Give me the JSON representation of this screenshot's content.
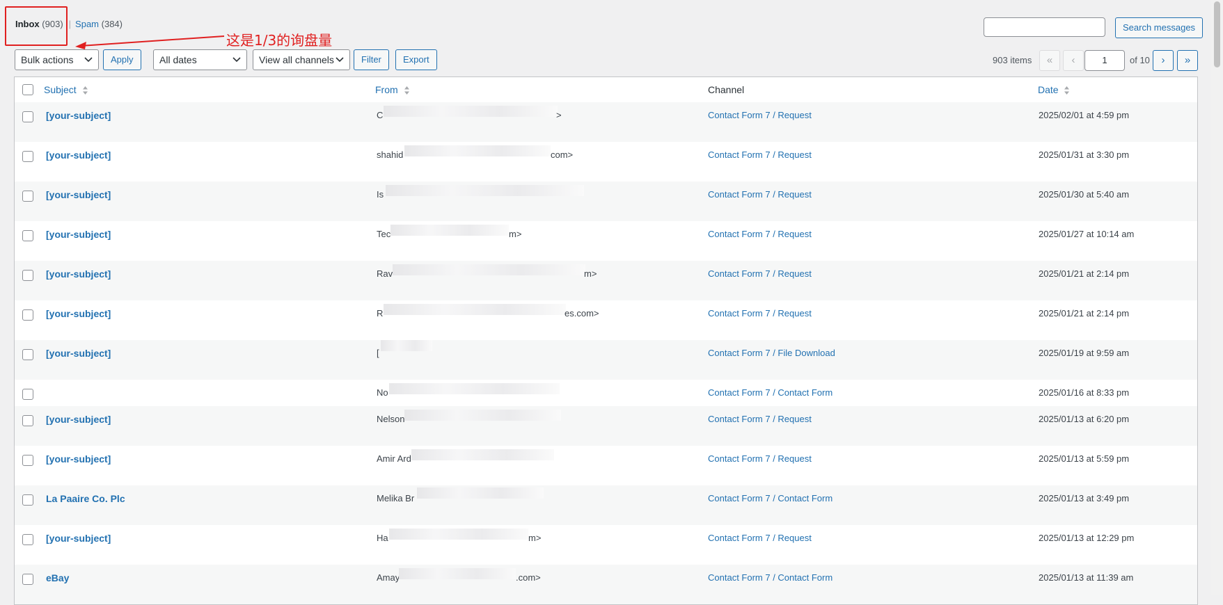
{
  "views": {
    "inbox_label": "Inbox",
    "inbox_count": "(903)",
    "separator": "|",
    "spam_label": "Spam",
    "spam_count": "(384)"
  },
  "annotation": {
    "text": "这是1/3的询盘量",
    "color": "#e02020"
  },
  "search": {
    "value": "",
    "button_label": "Search messages"
  },
  "toolbar": {
    "bulk_actions": "Bulk actions",
    "apply_label": "Apply",
    "dates_filter": "All dates",
    "channels_filter": "View all channels",
    "filter_label": "Filter",
    "export_label": "Export"
  },
  "pagination": {
    "items_count": "903 items",
    "first": "«",
    "prev": "‹",
    "current_page": "1",
    "of_total": "of 10",
    "next": "›",
    "last": "»"
  },
  "table": {
    "columns": {
      "subject": "Subject",
      "from": "From",
      "channel": "Channel",
      "date": "Date"
    },
    "rows": [
      {
        "subject": "[your-subject]",
        "from_start": "C",
        "from_end": ">",
        "channel": "Contact Form 7 / Request",
        "date": "2025/02/01 at 4:59 pm"
      },
      {
        "subject": "[your-subject]",
        "from_start": "shahid",
        "from_end": "com>",
        "channel": "Contact Form 7 / Request",
        "date": "2025/01/31 at 3:30 pm"
      },
      {
        "subject": "[your-subject]",
        "from_start": "Is",
        "from_end": "",
        "channel": "Contact Form 7 / Request",
        "date": "2025/01/30 at 5:40 am"
      },
      {
        "subject": "[your-subject]",
        "from_start": "Tec",
        "from_end": "m>",
        "channel": "Contact Form 7 / Request",
        "date": "2025/01/27 at 10:14 am"
      },
      {
        "subject": "[your-subject]",
        "from_start": "Rav",
        "from_end": "m>",
        "channel": "Contact Form 7 / Request",
        "date": "2025/01/21 at 2:14 pm"
      },
      {
        "subject": "[your-subject]",
        "from_start": "R",
        "from_end": "es.com>",
        "channel": "Contact Form 7 / Request",
        "date": "2025/01/21 at 2:14 pm"
      },
      {
        "subject": "[your-subject]",
        "from_start": "[",
        "from_end": "",
        "channel": "Contact Form 7 / File Download",
        "date": "2025/01/19 at 9:59 am"
      },
      {
        "subject": "",
        "from_start": "No",
        "from_end": "",
        "channel": "Contact Form 7 / Contact Form",
        "date": "2025/01/16 at 8:33 pm"
      },
      {
        "subject": "[your-subject]",
        "from_start": "Nelson",
        "from_end": "",
        "channel": "Contact Form 7 / Request",
        "date": "2025/01/13 at 6:20 pm"
      },
      {
        "subject": "[your-subject]",
        "from_start": "Amir Ard",
        "from_end": "",
        "channel": "Contact Form 7 / Request",
        "date": "2025/01/13 at 5:59 pm"
      },
      {
        "subject": "La Paaire Co. Plc",
        "from_start": "Melika Br",
        "from_end": "",
        "channel": "Contact Form 7 / Contact Form",
        "date": "2025/01/13 at 3:49 pm"
      },
      {
        "subject": "[your-subject]",
        "from_start": "Ha",
        "from_end": "m>",
        "channel": "Contact Form 7 / Request",
        "date": "2025/01/13 at 12:29 pm"
      },
      {
        "subject": "eBay",
        "from_start": "Amay",
        "from_end": ".com>",
        "channel": "Contact Form 7 / Contact Form",
        "date": "2025/01/13 at 11:39 am"
      }
    ]
  }
}
